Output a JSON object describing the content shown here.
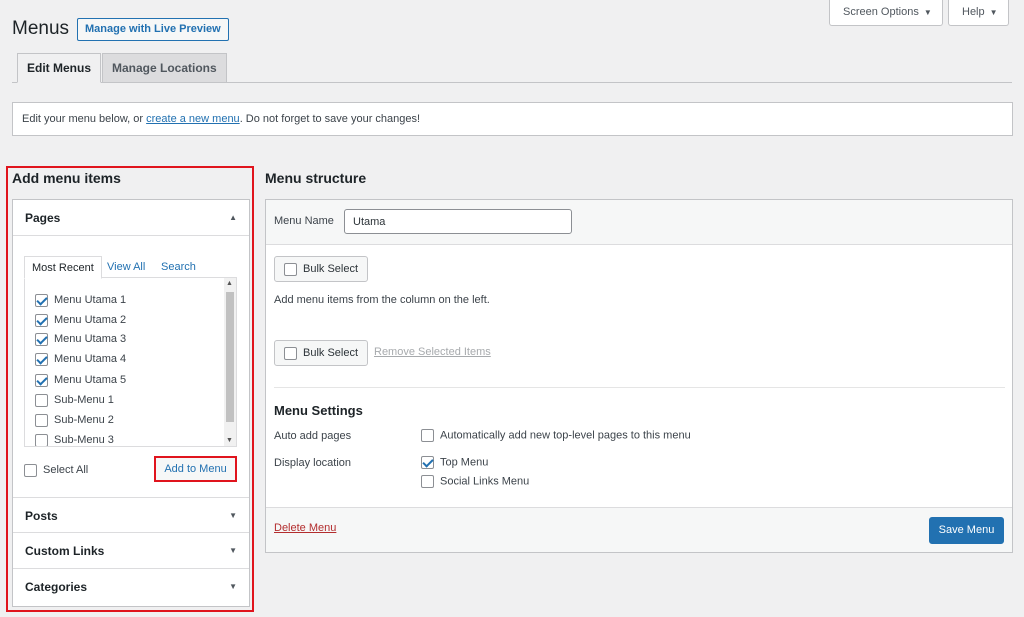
{
  "header": {
    "title": "Menus",
    "live_preview_label": "Manage with Live Preview",
    "screen_options_label": "Screen Options",
    "help_label": "Help"
  },
  "tabs": [
    {
      "label": "Edit Menus",
      "active": true
    },
    {
      "label": "Manage Locations",
      "active": false
    }
  ],
  "notice": {
    "before": "Edit your menu below, or ",
    "link": "create a new menu",
    "after": ". Do not forget to save your changes!"
  },
  "add_menu_items": {
    "title": "Add menu items",
    "pages": {
      "label": "Pages",
      "subtabs": [
        "Most Recent",
        "View All",
        "Search"
      ],
      "items": [
        {
          "label": "Menu Utama 1",
          "checked": true
        },
        {
          "label": "Menu Utama 2",
          "checked": true
        },
        {
          "label": "Menu Utama 3",
          "checked": true
        },
        {
          "label": "Menu Utama 4",
          "checked": true
        },
        {
          "label": "Menu Utama 5",
          "checked": true
        },
        {
          "label": "Sub-Menu 1",
          "checked": false
        },
        {
          "label": "Sub-Menu 2",
          "checked": false
        },
        {
          "label": "Sub-Menu 3",
          "checked": false
        }
      ],
      "select_all_label": "Select All",
      "add_button_label": "Add to Menu"
    },
    "sections": [
      "Posts",
      "Custom Links",
      "Categories"
    ]
  },
  "menu_structure": {
    "title": "Menu structure",
    "name_label": "Menu Name",
    "name_value": "Utama",
    "bulk_select_label": "Bulk Select",
    "hint": "Add menu items from the column on the left.",
    "remove_selected_label": "Remove Selected Items",
    "settings_title": "Menu Settings",
    "auto_add_label": "Auto add pages",
    "auto_add_option": "Automatically add new top-level pages to this menu",
    "display_location_label": "Display location",
    "locations": [
      {
        "label": "Top Menu",
        "checked": true
      },
      {
        "label": "Social Links Menu",
        "checked": false
      }
    ],
    "delete_label": "Delete Menu",
    "save_label": "Save Menu"
  },
  "colors": {
    "accent": "#2271b1",
    "highlight": "#e0141d",
    "delete": "#b32d2e",
    "background": "#f0f0f1"
  }
}
